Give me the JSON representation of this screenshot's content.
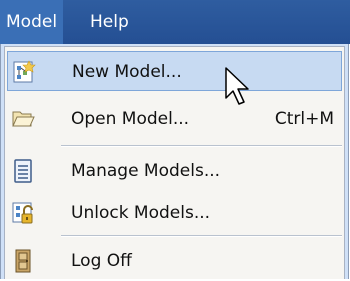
{
  "menubar": {
    "items": [
      {
        "label": "Model",
        "active": true
      },
      {
        "label": "Help",
        "active": false
      }
    ]
  },
  "menu": {
    "items": [
      {
        "label": "New Model...",
        "icon": "new-model-icon",
        "highlighted": true,
        "shortcut": ""
      },
      {
        "label": "Open Model...",
        "icon": "open-folder-icon",
        "highlighted": false,
        "shortcut": "Ctrl+M"
      },
      {
        "label": "Manage Models...",
        "icon": "manage-models-icon",
        "highlighted": false,
        "shortcut": ""
      },
      {
        "label": "Unlock Models...",
        "icon": "unlock-models-icon",
        "highlighted": false,
        "shortcut": ""
      },
      {
        "label": "Log Off",
        "icon": "log-off-icon",
        "highlighted": false,
        "shortcut": ""
      }
    ]
  },
  "colors": {
    "menubar": "#2f5da0",
    "highlight": "#c7daf2",
    "menu_background": "#f6f5f2"
  }
}
